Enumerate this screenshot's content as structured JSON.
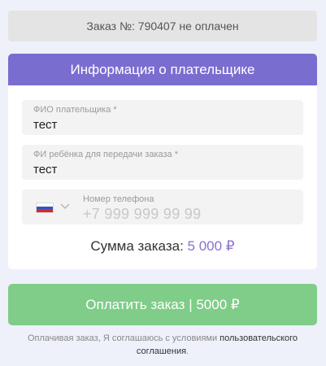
{
  "order": {
    "status_text": "Заказ №: 790407 не оплачен"
  },
  "payer_card": {
    "title": "Информация о плательщике",
    "fio": {
      "label": "ФИО плательщика *",
      "value": "тест"
    },
    "child": {
      "label": "ФИ ребёнка для передачи заказа *",
      "value": "тест"
    },
    "phone": {
      "label": "Номер телефона",
      "placeholder": "+7 999 999 99 99",
      "country_flag": "ru-flag-icon"
    },
    "sum": {
      "label": "Сумма заказа:",
      "amount": "5 000 ₽"
    }
  },
  "pay_button": {
    "label": "Оплатить заказ | 5000 ₽"
  },
  "agreement": {
    "text": "Оплачивая заказ, Я соглашаюсь с условиями",
    "link": "пользовательского соглашения",
    "end": "."
  },
  "colors": {
    "header": "#7a6dd0",
    "pay_button": "#7fcd88",
    "amount": "#8c6fd0",
    "background": "#eef1fa"
  }
}
